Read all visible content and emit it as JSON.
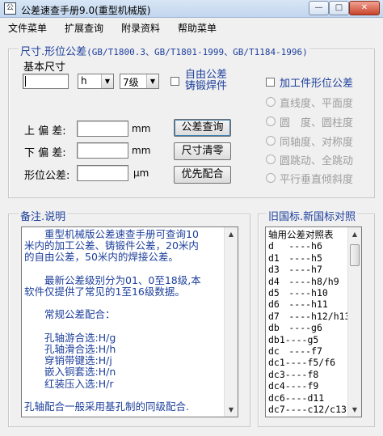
{
  "window": {
    "title": "公差速查手册9.0(重型机械版)",
    "icon": "app-icon",
    "controls": [
      "minimize",
      "maximize",
      "close"
    ]
  },
  "menu": [
    "文件菜单",
    "扩展查询",
    "附录资料",
    "帮助菜单"
  ],
  "tolerance": {
    "group_title": "尺寸.形位公差",
    "standards": "(GB/T1800.3、GB/T1801-1999、GB/T1184-1996)",
    "basic_size_label": "基本尺寸",
    "basic_size_value": "",
    "shaft_hole_select": "h",
    "grade_select": "7级",
    "free_tol_label_1": "自由公差",
    "free_tol_label_2": "铸锻焊件",
    "free_tol_checked": false,
    "upper_dev_label": "上 偏 差:",
    "lower_dev_label": "下 偏 差:",
    "form_tol_label": "形位公差:",
    "upper_dev_value": "",
    "lower_dev_value": "",
    "form_tol_value": "",
    "unit_mm": "mm",
    "unit_um": "μm",
    "query_button": "公差查询",
    "clear_button": "尺寸清零",
    "fit_button": "优先配合"
  },
  "form_tol": {
    "checkbox_label": "加工件形位公差",
    "checked": false,
    "options": [
      "直线度、平面度",
      "圆　度、圆柱度",
      "同轴度、对称度",
      "圆跳动、全跳动",
      "平行垂直倾斜度"
    ]
  },
  "notes": {
    "group_title": "备注.说明",
    "lines": [
      "　　重型机械版公差速查手册可查询10",
      "米内的加工公差、铸锻件公差，20米内",
      "的自由公差，50米内的焊接公差。",
      "",
      "　　最新公差级别分为01、0至18级,本",
      "软件仅提供了常见的1至16级数据。",
      "",
      "　　常规公差配合：",
      "",
      "　　孔轴游合选:H/g",
      "　　孔轴滑合选:H/h",
      "　　穿销带键选:H/j",
      "　　嵌入铜套选:H/n",
      "　　红装压入选:H/r",
      "",
      " 孔轴配合一般采用基孔制的同级配合."
    ]
  },
  "old_new": {
    "group_title": "旧国标.新国标对照",
    "lines": [
      "轴用公差对照表",
      "d　 ----h6",
      "d1　----h5",
      "d3　----h7",
      "d4　----h8/h9",
      "d5　----h10",
      "d6　----h11",
      "d7　----h12/h13",
      "db　----g6",
      "db1----g5",
      "dc　----f7",
      "dc1----f5/f6",
      "dc3----f8",
      "dc4----f9",
      "dc6----d11",
      "dc7----c12/c13"
    ]
  }
}
